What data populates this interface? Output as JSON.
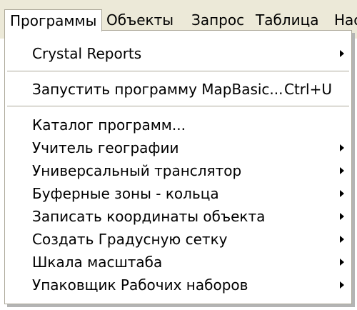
{
  "menubar": {
    "items": [
      {
        "label": "Программы"
      },
      {
        "label": "Объекты"
      },
      {
        "label": "Запрос"
      },
      {
        "label": "Таблица"
      },
      {
        "label": "Нас"
      }
    ]
  },
  "menu": {
    "sections": [
      {
        "items": [
          {
            "label": "Crystal Reports",
            "has_submenu": true
          }
        ]
      },
      {
        "items": [
          {
            "label": "Запустить программу MapBasic...",
            "shortcut": "Ctrl+U"
          }
        ]
      },
      {
        "items": [
          {
            "label": "Каталог программ..."
          },
          {
            "label": "Учитель географии",
            "has_submenu": true
          },
          {
            "label": "Универсальный транслятор",
            "has_submenu": true
          },
          {
            "label": "Буферные зоны - кольца",
            "has_submenu": true
          },
          {
            "label": "Записать координаты объекта",
            "has_submenu": true
          },
          {
            "label": "Создать Градусную сетку",
            "has_submenu": true
          },
          {
            "label": "Шкала масштаба",
            "has_submenu": true
          },
          {
            "label": "Упаковщик Рабочих наборов",
            "has_submenu": true
          }
        ]
      }
    ]
  }
}
